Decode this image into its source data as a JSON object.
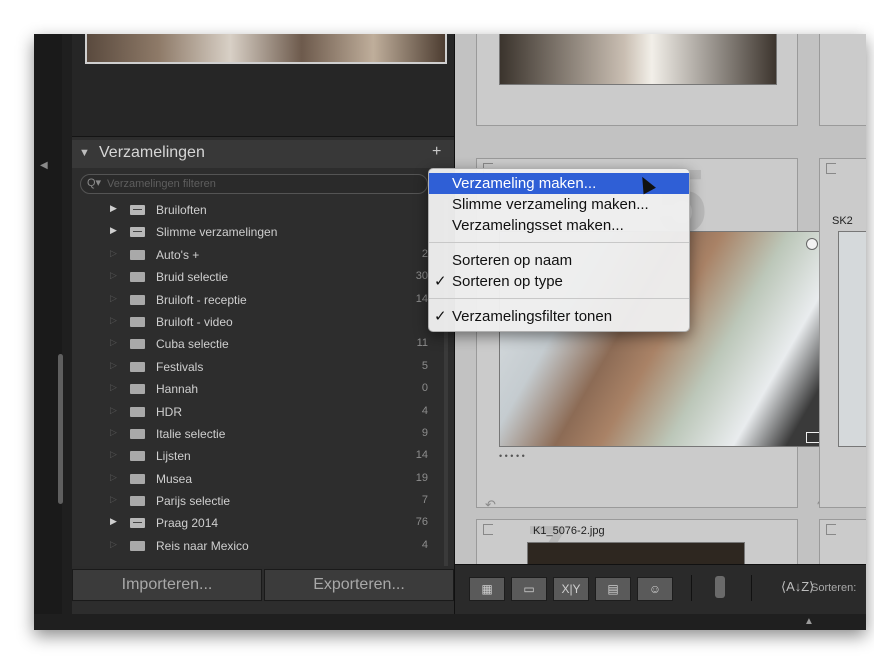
{
  "panel": {
    "section_title": "Verzamelingen",
    "add_label": "+",
    "filter_placeholder": "Verzamelingen filteren",
    "items": [
      {
        "label": "Bruiloften",
        "count": "",
        "type": "set",
        "expandable": true
      },
      {
        "label": "Slimme verzamelingen",
        "count": "",
        "type": "set",
        "expandable": true
      },
      {
        "label": "Auto's +",
        "count": "2",
        "type": "collection",
        "expandable": false
      },
      {
        "label": "Bruid selectie",
        "count": "30",
        "type": "collection",
        "expandable": false
      },
      {
        "label": "Bruiloft - receptie",
        "count": "14",
        "type": "collection",
        "expandable": false
      },
      {
        "label": "Bruiloft - video",
        "count": "",
        "type": "collection",
        "expandable": false
      },
      {
        "label": "Cuba selectie",
        "count": "11",
        "type": "collection",
        "expandable": false
      },
      {
        "label": "Festivals",
        "count": "5",
        "type": "collection",
        "expandable": false
      },
      {
        "label": "Hannah",
        "count": "0",
        "type": "collection",
        "expandable": false
      },
      {
        "label": "HDR",
        "count": "4",
        "type": "collection",
        "expandable": false
      },
      {
        "label": "Italie selectie",
        "count": "9",
        "type": "collection",
        "expandable": false
      },
      {
        "label": "Lijsten",
        "count": "14",
        "type": "collection",
        "expandable": false
      },
      {
        "label": "Musea",
        "count": "19",
        "type": "collection",
        "expandable": false
      },
      {
        "label": "Parijs selectie",
        "count": "7",
        "type": "collection",
        "expandable": false
      },
      {
        "label": "Praag 2014",
        "count": "76",
        "type": "set",
        "expandable": true
      },
      {
        "label": "Reis naar Mexico",
        "count": "4",
        "type": "collection",
        "expandable": false
      }
    ]
  },
  "bottom_bar": {
    "import_label": "Importeren...",
    "export_label": "Exporteren..."
  },
  "context_menu": {
    "items": [
      {
        "label": "Verzameling maken...",
        "checked": false,
        "highlighted": true
      },
      {
        "label": "Slimme verzameling maken...",
        "checked": false,
        "highlighted": false
      },
      {
        "label": "Verzamelingsset maken...",
        "checked": false,
        "highlighted": false
      },
      {
        "label": "Sorteren op naam",
        "checked": false,
        "highlighted": false
      },
      {
        "label": "Sorteren op type",
        "checked": true,
        "highlighted": false
      },
      {
        "label": "Verzamelingsfilter tonen",
        "checked": true,
        "highlighted": false
      }
    ],
    "check_glyph": "✓"
  },
  "grid": {
    "cell_label_top_right": "SK2",
    "cell_label_bottom": "K1_5076-2.jpg",
    "dots": "• • • • •"
  },
  "toolbar": {
    "view_buttons": [
      "grid-view",
      "loupe-view",
      "compare-view",
      "survey-view",
      "people-view"
    ],
    "compare_label": "X|Y",
    "sort_label": "Sorteren:"
  },
  "colors": {
    "menu_highlight": "#2f5fd6",
    "panel_bg": "#2d2d2d",
    "grid_bg": "#c2c2c2"
  }
}
